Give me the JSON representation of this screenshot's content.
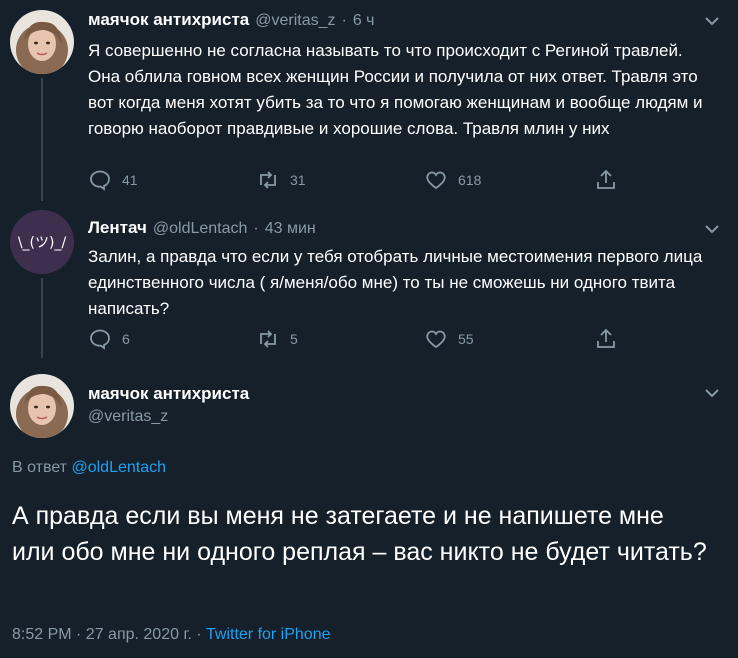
{
  "tweets": [
    {
      "author": "маячок антихриста",
      "handle": "@veritas_z",
      "time": "6 ч",
      "text": "Я совершенно не согласна называть то что происходит с Региной травлей. Она облила говном всех женщин России и получила от них ответ. Травля это вот когда меня хотят убить за то что я помогаю женщинам и вообще людям и говорю наоборот правдивые и хорошие слова. Травля млин у них",
      "replies": "41",
      "retweets": "31",
      "likes": "618"
    },
    {
      "author": "Лентач",
      "handle": "@oldLentach",
      "time": "43 мин",
      "avatar_text": "\\_(ツ)_/",
      "text": "Залин, а правда что если у тебя отобрать личные местоимения первого лица единственного числа ( я/меня/обо мне) то ты не сможешь ни одного твита написать?",
      "replies": "6",
      "retweets": "5",
      "likes": "55"
    }
  ],
  "main": {
    "author": "маячок антихриста",
    "handle": "@veritas_z",
    "reply_prefix": "В ответ",
    "reply_to": "@oldLentach",
    "text": "А правда если вы меня не затегаете и не напишете мне или обо мне ни одного реплая – вас никто не будет читать?",
    "timestamp": "8:52 PM · 27 апр. 2020 г. ·",
    "source": "Twitter for iPhone"
  },
  "separator": "·",
  "colors": {
    "background": "#15202b",
    "muted": "#8899a6",
    "link": "#1da1f2",
    "thread_line": "#38444d"
  }
}
